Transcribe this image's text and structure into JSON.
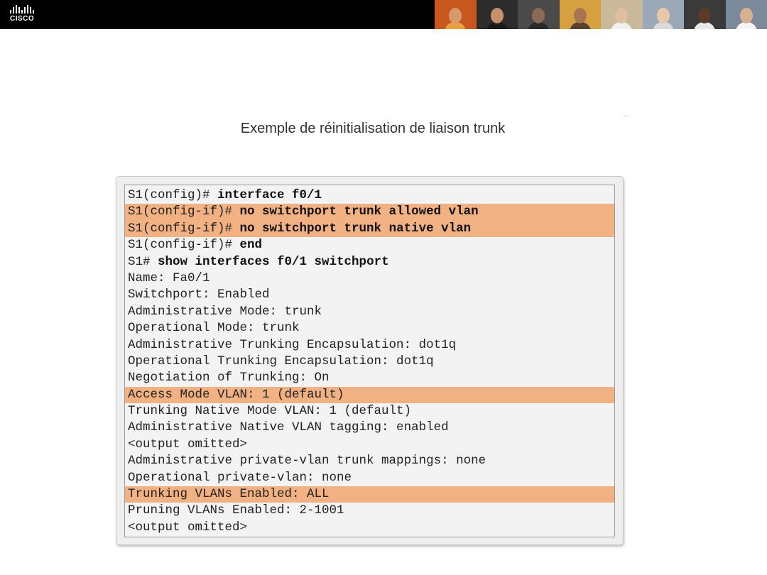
{
  "header": {
    "logo_text": "CISCO",
    "logo_bar_heights": [
      5,
      9,
      12,
      9,
      5,
      9,
      12,
      9,
      5
    ],
    "photos": [
      {
        "bg": "#c8571e",
        "skin": "#d89a6a",
        "shirt": "#e8a040"
      },
      {
        "bg": "#2c2c2c",
        "skin": "#c98e6a",
        "shirt": "#1a1a1a"
      },
      {
        "bg": "#4a4a4a",
        "skin": "#8a6a54",
        "shirt": "#2a2a2a"
      },
      {
        "bg": "#d4a040",
        "skin": "#a87452",
        "shirt": "#5a4030"
      },
      {
        "bg": "#c9b89a",
        "skin": "#e0bfa0",
        "shirt": "#f0f0f0"
      },
      {
        "bg": "#9aa8b8",
        "skin": "#e8c8a8",
        "shirt": "#dadada"
      },
      {
        "bg": "#3a3a3a",
        "skin": "#5a3a28",
        "shirt": "#e8e8e8"
      },
      {
        "bg": "#7a8a9a",
        "skin": "#d8b090",
        "shirt": "#f5f5f5"
      }
    ]
  },
  "title": "Exemple de réinitialisation de liaison trunk",
  "terminal": {
    "highlight_color": "#f2b182",
    "lines": [
      {
        "prompt": "S1(config)# ",
        "cmd": "interface f0/1",
        "highlight": false
      },
      {
        "prompt": "S1(config-if)# ",
        "cmd": "no switchport trunk allowed vlan",
        "highlight": true
      },
      {
        "prompt": "S1(config-if)# ",
        "cmd": "no switchport trunk native vlan",
        "highlight": true
      },
      {
        "prompt": "S1(config-if)# ",
        "cmd": "end",
        "highlight": false
      },
      {
        "prompt": "S1# ",
        "cmd": "show interfaces f0/1 switchport",
        "highlight": false
      },
      {
        "prompt": "Name: Fa0/1",
        "cmd": "",
        "highlight": false
      },
      {
        "prompt": "Switchport: Enabled",
        "cmd": "",
        "highlight": false
      },
      {
        "prompt": "Administrative Mode: trunk",
        "cmd": "",
        "highlight": false
      },
      {
        "prompt": "Operational Mode: trunk",
        "cmd": "",
        "highlight": false
      },
      {
        "prompt": "Administrative Trunking Encapsulation: dot1q",
        "cmd": "",
        "highlight": false
      },
      {
        "prompt": "Operational Trunking Encapsulation: dot1q",
        "cmd": "",
        "highlight": false
      },
      {
        "prompt": "Negotiation of Trunking: On",
        "cmd": "",
        "highlight": false
      },
      {
        "prompt": "Access Mode VLAN: 1 (default)",
        "cmd": "",
        "highlight": true
      },
      {
        "prompt": "Trunking Native Mode VLAN: 1 (default)",
        "cmd": "",
        "highlight": false
      },
      {
        "prompt": "Administrative Native VLAN tagging: enabled",
        "cmd": "",
        "highlight": false
      },
      {
        "prompt": "<output omitted>",
        "cmd": "",
        "highlight": false
      },
      {
        "prompt": "Administrative private-vlan trunk mappings: none",
        "cmd": "",
        "highlight": false
      },
      {
        "prompt": "Operational private-vlan: none",
        "cmd": "",
        "highlight": false
      },
      {
        "prompt": "Trunking VLANs Enabled: ALL",
        "cmd": "",
        "highlight": true
      },
      {
        "prompt": "Pruning VLANs Enabled: 2-1001",
        "cmd": "",
        "highlight": false
      },
      {
        "prompt": "<output omitted>",
        "cmd": "",
        "highlight": false
      }
    ]
  }
}
